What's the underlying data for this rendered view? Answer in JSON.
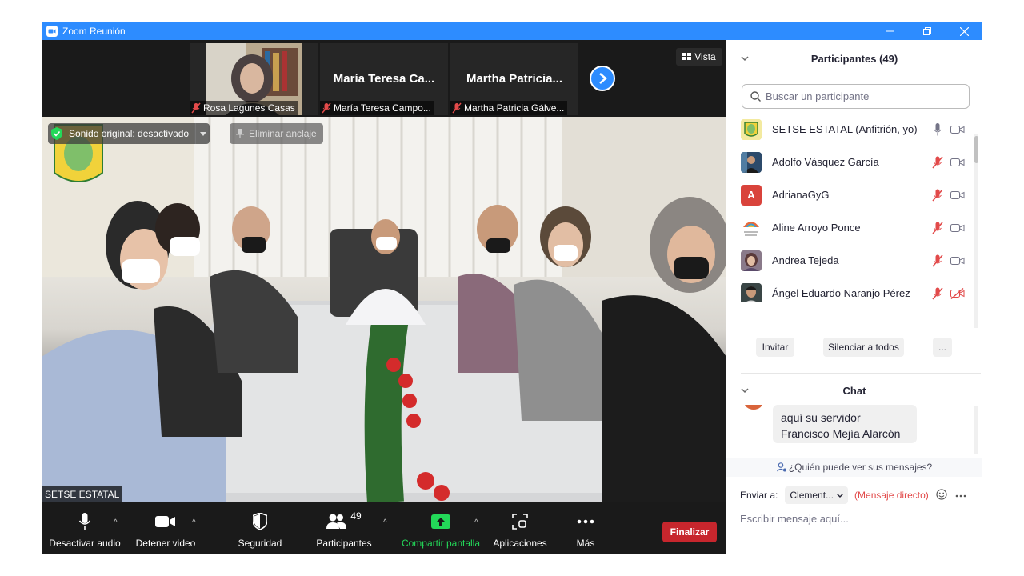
{
  "window": {
    "title": "Zoom Reunión"
  },
  "strip": {
    "thumbs": [
      {
        "name": "Rosa Lagunes Casas"
      },
      {
        "big": "María Teresa Ca...",
        "name": "María Teresa Campo..."
      },
      {
        "big": "Martha  Patricia...",
        "name": "Martha Patricia Gálve..."
      }
    ],
    "view_label": "Vista"
  },
  "main": {
    "sound_label": "Sonido original: desactivado",
    "unpin_label": "Eliminar anclaje",
    "speaker_name": "SETSE ESTATAL"
  },
  "toolbar": {
    "mute": "Desactivar audio",
    "video": "Detener video",
    "security": "Seguridad",
    "participants": "Participantes",
    "participants_count": "49",
    "share": "Compartir pantalla",
    "apps": "Aplicaciones",
    "more": "Más",
    "end": "Finalizar"
  },
  "participants_panel": {
    "title": "Participantes (49)",
    "search_placeholder": "Buscar un participante",
    "list": [
      {
        "name": "SETSE ESTATAL (Anfitrión, yo)",
        "avatar_color": "#e8e07a",
        "mic": "on",
        "cam": "off"
      },
      {
        "name": "Adolfo Vásquez García",
        "avatar_color": "#3a5f8a",
        "mic": "muted",
        "cam": "off"
      },
      {
        "name": "AdrianaGyG",
        "avatar_letter": "A",
        "avatar_color": "#d9433b",
        "mic": "muted",
        "cam": "off"
      },
      {
        "name": "Aline Arroyo Ponce",
        "avatar_color": "#ffffff",
        "mic": "muted",
        "cam": "off"
      },
      {
        "name": "Andrea Tejeda",
        "avatar_color": "#7a6a7a",
        "mic": "muted",
        "cam": "off"
      },
      {
        "name": "Ángel Eduardo Naranjo Pérez",
        "avatar_color": "#2f3a3a",
        "mic": "muted",
        "cam": "disabled"
      }
    ],
    "invite": "Invitar",
    "mute_all": "Silenciar a todos",
    "more": "..."
  },
  "chat": {
    "title": "Chat",
    "message_line1": "aquí su servidor",
    "message_line2": "Francisco Mejía Alarcón",
    "who_can_see": "¿Quién puede ver sus mensajes?",
    "send_to_label": "Enviar a:",
    "recipient": "Clement...",
    "direct_label": "(Mensaje directo)",
    "input_placeholder": "Escribir mensaje aquí..."
  },
  "colors": {
    "zoom_blue": "#2d8cff",
    "end_red": "#c7262d",
    "muted_red": "#e24a4a",
    "share_green": "#23d959"
  }
}
